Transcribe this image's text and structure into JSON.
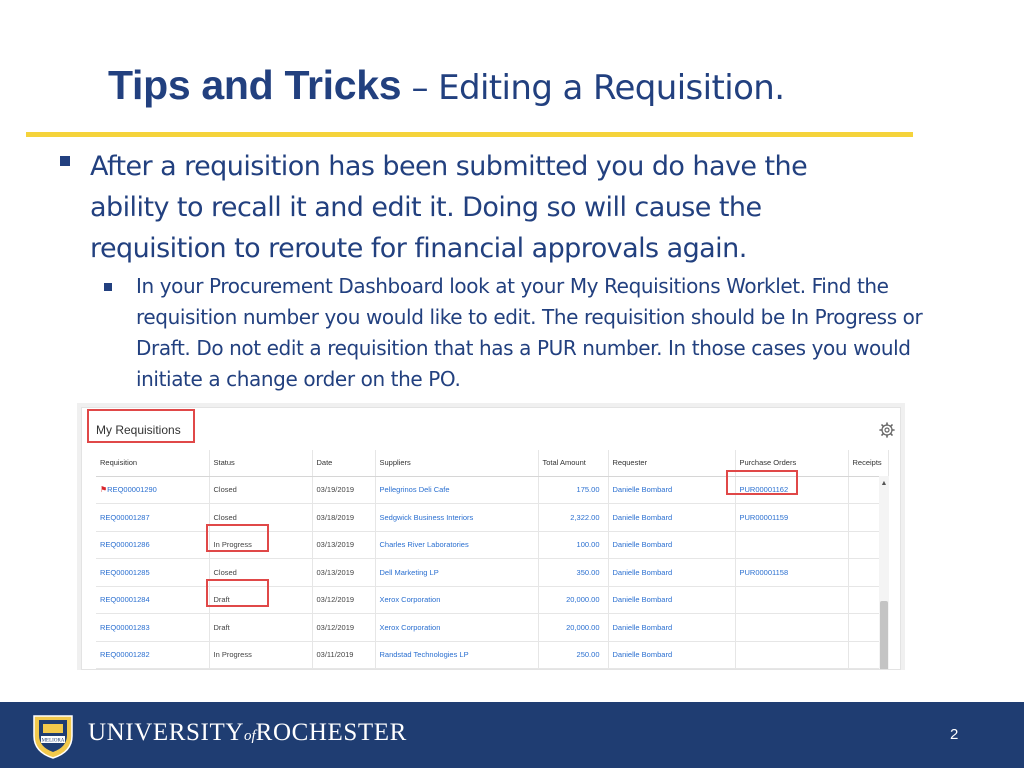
{
  "slide": {
    "title_bold": "Tips and Tricks",
    "title_rest": " – Editing a Requisition.",
    "bullet1": "After a requisition has been submitted you do have the ability to recall it and edit it.  Doing so will cause the requisition to reroute for financial approvals again.",
    "bullet2": "In your Procurement Dashboard look at your My Requisitions Worklet.  Find the requisition number you would like to edit.  The requisition should be In Progress or Draft.  Do not edit a requisition that has a PUR number.  In those cases you would initiate a change order on the PO.",
    "page_number": "2"
  },
  "colors": {
    "title": "#22407f",
    "rule": "#f5d33b",
    "footer": "#1f3d72",
    "link": "#2a6fd0",
    "highlight": "#e04848"
  },
  "worklet": {
    "title": "My Requisitions",
    "settings_icon": "gear-icon",
    "columns": [
      "Requisition",
      "Status",
      "Date",
      "Suppliers",
      "Total Amount",
      "Requester",
      "Purchase Orders",
      "Receipts"
    ],
    "rows": [
      {
        "req": "REQ00001290",
        "flagged": true,
        "status": "Closed",
        "date": "03/19/2019",
        "supplier": "Pellegrinos Deli Cafe",
        "amount": "175.00",
        "requester": "Danielle Bombard",
        "po": "PUR00001162",
        "receipts": ""
      },
      {
        "req": "REQ00001287",
        "flagged": false,
        "status": "Closed",
        "date": "03/18/2019",
        "supplier": "Sedgwick Business Interiors",
        "amount": "2,322.00",
        "requester": "Danielle Bombard",
        "po": "PUR00001159",
        "receipts": ""
      },
      {
        "req": "REQ00001286",
        "flagged": false,
        "status": "In Progress",
        "date": "03/13/2019",
        "supplier": "Charles River Laboratories",
        "amount": "100.00",
        "requester": "Danielle Bombard",
        "po": "",
        "receipts": ""
      },
      {
        "req": "REQ00001285",
        "flagged": false,
        "status": "Closed",
        "date": "03/13/2019",
        "supplier": "Dell Marketing LP",
        "amount": "350.00",
        "requester": "Danielle Bombard",
        "po": "PUR00001158",
        "receipts": ""
      },
      {
        "req": "REQ00001284",
        "flagged": false,
        "status": "Draft",
        "date": "03/12/2019",
        "supplier": "Xerox Corporation",
        "amount": "20,000.00",
        "requester": "Danielle Bombard",
        "po": "",
        "receipts": ""
      },
      {
        "req": "REQ00001283",
        "flagged": false,
        "status": "Draft",
        "date": "03/12/2019",
        "supplier": "Xerox Corporation",
        "amount": "20,000.00",
        "requester": "Danielle Bombard",
        "po": "",
        "receipts": ""
      },
      {
        "req": "REQ00001282",
        "flagged": false,
        "status": "In Progress",
        "date": "03/11/2019",
        "supplier": "Randstad Technologies LP",
        "amount": "250.00",
        "requester": "Danielle Bombard",
        "po": "",
        "receipts": ""
      }
    ]
  },
  "footer": {
    "logo_text_1": "UNIVERSITY",
    "logo_text_of": "of",
    "logo_text_2": "ROCHESTER",
    "seal_text": "MELIORA"
  }
}
